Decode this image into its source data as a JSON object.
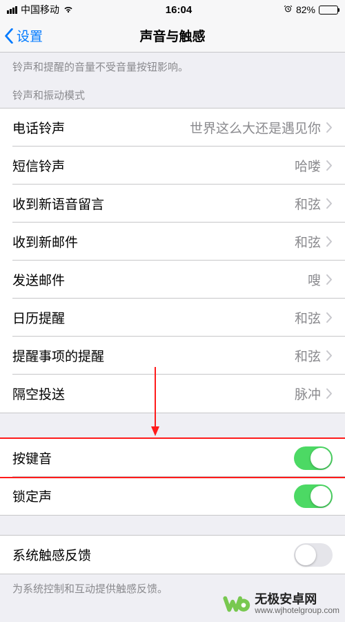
{
  "status_bar": {
    "carrier": "中国移动",
    "time": "16:04",
    "battery_percent": "82%"
  },
  "nav": {
    "back_label": "设置",
    "title": "声音与触感"
  },
  "top_description": "铃声和提醒的音量不受音量按钮影响。",
  "ringtone_section_header": "铃声和振动模式",
  "ringtone_cells": [
    {
      "label": "电话铃声",
      "value": "世界这么大还是遇见你"
    },
    {
      "label": "短信铃声",
      "value": "哈喽"
    },
    {
      "label": "收到新语音留言",
      "value": "和弦"
    },
    {
      "label": "收到新邮件",
      "value": "和弦"
    },
    {
      "label": "发送邮件",
      "value": "嗖"
    },
    {
      "label": "日历提醒",
      "value": "和弦"
    },
    {
      "label": "提醒事项的提醒",
      "value": "和弦"
    },
    {
      "label": "隔空投送",
      "value": "脉冲"
    }
  ],
  "toggle_cells": [
    {
      "label": "按键音",
      "on": true
    },
    {
      "label": "锁定声",
      "on": true
    }
  ],
  "haptic_cells": [
    {
      "label": "系统触感反馈",
      "on": false
    }
  ],
  "haptic_description": "为系统控制和互动提供触感反馈。",
  "watermark": {
    "brand": "无极安卓网",
    "url": "www.wjhotelgroup.com"
  },
  "highlighted_cell_label": "按键音"
}
